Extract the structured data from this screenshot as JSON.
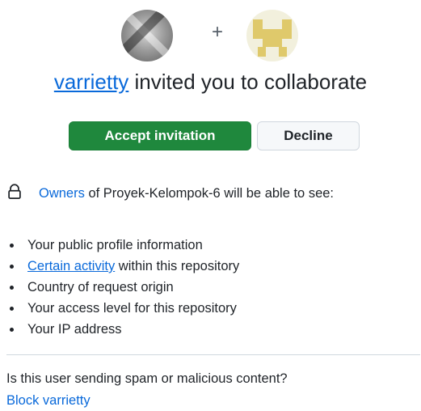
{
  "avatars": {
    "inviter_icon": "user-avatar-photo",
    "separator": "+",
    "repo_icon": "repository-identicon",
    "identicon_color": "#dfc96b"
  },
  "headline": {
    "inviter": "varrietty",
    "text": " invited you to collaborate"
  },
  "actions": {
    "accept_label": "Accept invitation",
    "decline_label": "Decline"
  },
  "notice": {
    "icon": "lock-icon",
    "owners_link": "Owners",
    "text": " of Proyek-Kelompok-6 will be able to see:"
  },
  "permissions": {
    "item1": "Your public profile information",
    "item2_link": "Certain activity",
    "item2_rest": " within this repository",
    "item3": "Country of request origin",
    "item4": "Your access level for this repository",
    "item5": "Your IP address"
  },
  "spam": {
    "question": "Is this user sending spam or malicious content?",
    "block_label": "Block varrietty"
  },
  "colors": {
    "accent": "#0969da",
    "primary_button": "#1f883d",
    "text": "#1f2328"
  }
}
